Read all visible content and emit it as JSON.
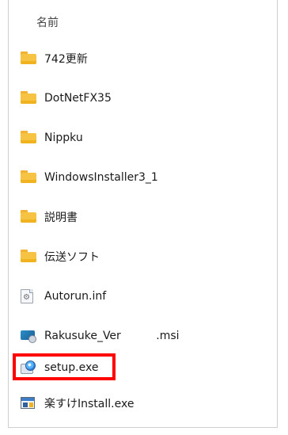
{
  "header": {
    "name_label": "名前"
  },
  "files": [
    {
      "name": "742更新",
      "type": "folder"
    },
    {
      "name": "DotNetFX35",
      "type": "folder"
    },
    {
      "name": "Nippku",
      "type": "folder"
    },
    {
      "name": "WindowsInstaller3_1",
      "type": "folder"
    },
    {
      "name": "説明書",
      "type": "folder"
    },
    {
      "name": "伝送ソフト",
      "type": "folder"
    },
    {
      "name": "Autorun.inf",
      "type": "inf"
    },
    {
      "name": "Rakusuke_Ver          .msi",
      "type": "msi"
    },
    {
      "name": "setup.exe",
      "type": "setup"
    },
    {
      "name": "楽すけInstall.exe",
      "type": "exe"
    }
  ],
  "highlight": {
    "target": "setup.exe",
    "color": "#ff0000"
  }
}
